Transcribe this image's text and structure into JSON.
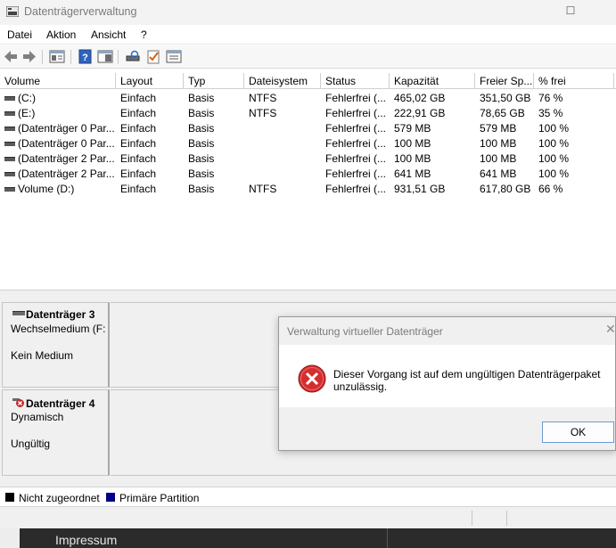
{
  "window": {
    "title": "Datenträgerverwaltung"
  },
  "menu": {
    "items": [
      "Datei",
      "Aktion",
      "Ansicht",
      "?"
    ]
  },
  "toolbar": {
    "icons": [
      "back-arrow-icon",
      "forward-arrow-icon",
      "disk-list-icon",
      "help-icon",
      "panel-icon",
      "rescan-icon",
      "check-icon",
      "properties-icon"
    ]
  },
  "volumes": {
    "columns": [
      "Volume",
      "Layout",
      "Typ",
      "Dateisystem",
      "Status",
      "Kapazität",
      "Freier Sp...",
      "% frei"
    ],
    "rows": [
      {
        "volume": " (C:)",
        "layout": "Einfach",
        "typ": "Basis",
        "fs": "NTFS",
        "status": "Fehlerfrei (...",
        "capacity": "465,02 GB",
        "free": "351,50 GB",
        "pct": "76 %"
      },
      {
        "volume": " (E:)",
        "layout": "Einfach",
        "typ": "Basis",
        "fs": "NTFS",
        "status": "Fehlerfrei (...",
        "capacity": "222,91 GB",
        "free": "78,65 GB",
        "pct": "35 %"
      },
      {
        "volume": "(Datenträger 0 Par...",
        "layout": "Einfach",
        "typ": "Basis",
        "fs": "",
        "status": "Fehlerfrei (...",
        "capacity": "579 MB",
        "free": "579 MB",
        "pct": "100 %"
      },
      {
        "volume": "(Datenträger 0 Par...",
        "layout": "Einfach",
        "typ": "Basis",
        "fs": "",
        "status": "Fehlerfrei (...",
        "capacity": "100 MB",
        "free": "100 MB",
        "pct": "100 %"
      },
      {
        "volume": "(Datenträger 2 Par...",
        "layout": "Einfach",
        "typ": "Basis",
        "fs": "",
        "status": "Fehlerfrei (...",
        "capacity": "100 MB",
        "free": "100 MB",
        "pct": "100 %"
      },
      {
        "volume": "(Datenträger 2 Par...",
        "layout": "Einfach",
        "typ": "Basis",
        "fs": "",
        "status": "Fehlerfrei (...",
        "capacity": "641 MB",
        "free": "641 MB",
        "pct": "100 %"
      },
      {
        "volume": "Volume (D:)",
        "layout": "Einfach",
        "typ": "Basis",
        "fs": "NTFS",
        "status": "Fehlerfrei (...",
        "capacity": "931,51 GB",
        "free": "617,80 GB",
        "pct": "66 %"
      }
    ]
  },
  "disks": [
    {
      "name": "Datenträger 3",
      "line1": "Wechselmedium (F:",
      "line2": "Kein Medium"
    },
    {
      "name": "Datenträger 4",
      "line1": "Dynamisch",
      "line2": "Ungültig"
    }
  ],
  "legend": {
    "items": [
      {
        "label": "Nicht zugeordnet",
        "color": "#000000"
      },
      {
        "label": "Primäre Partition",
        "color": "#00008b"
      }
    ]
  },
  "taskbar": {
    "label": "Impressum"
  },
  "dialog": {
    "title": "Verwaltung virtueller Datenträger",
    "message_line1": "Dieser Vorgang ist auf dem ungültigen Datenträgerpaket",
    "message_line2": "unzulässig.",
    "ok_label": "OK",
    "icon": "error-icon"
  }
}
